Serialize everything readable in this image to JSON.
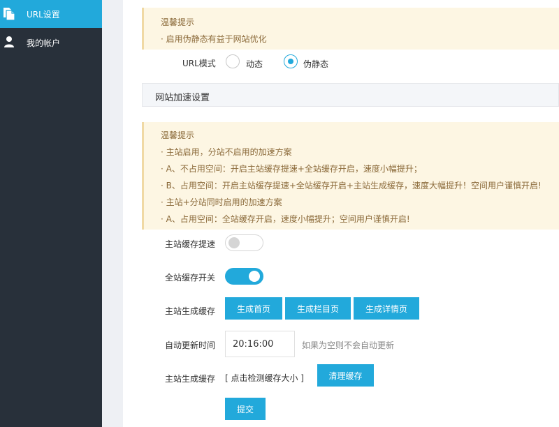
{
  "sidebar": {
    "items": [
      {
        "label": "URL设置",
        "icon": "copy-icon",
        "active": true
      },
      {
        "label": "我的帐户",
        "icon": "user-icon",
        "active": false
      }
    ]
  },
  "tip1": {
    "title": "温馨提示",
    "lines": [
      "· 启用伪静态有益于网站优化"
    ]
  },
  "url_mode": {
    "label": "URL模式",
    "options": [
      {
        "label": "动态",
        "checked": false
      },
      {
        "label": "伪静态",
        "checked": true
      }
    ]
  },
  "section": {
    "title": "网站加速设置"
  },
  "tip2": {
    "title": "温馨提示",
    "lines": [
      "· 主站启用，分站不启用的加速方案",
      "· A、不占用空间：开启主站缓存提速+全站缓存开启，速度小幅提升；",
      "· B、占用空间：开启主站缓存提速+全站缓存开启+主站生成缓存，速度大幅提升！空间用户谨慎开启!",
      "· 主站+分站同时启用的加速方案",
      "· A、占用空间：全站缓存开启，速度小幅提升；空间用户谨慎开启!"
    ]
  },
  "form": {
    "main_cache_speedup": {
      "label": "主站缓存提速",
      "on": false
    },
    "site_cache_switch": {
      "label": "全站缓存开关",
      "on": true
    },
    "generate_cache": {
      "label": "主站生成缓存",
      "buttons": [
        "生成首页",
        "生成栏目页",
        "生成详情页"
      ]
    },
    "auto_update": {
      "label": "自动更新时间",
      "value": "20:16:00",
      "hint": "如果为空则不会自动更新"
    },
    "cache_size": {
      "label": "主站生成缓存",
      "link": "[ 点击检测缓存大小 ]",
      "clear_button": "清理缓存"
    },
    "submit": "提交"
  },
  "colors": {
    "accent": "#22a9db",
    "sidebar_bg": "#28303a",
    "tip_bg": "#fdf6e3",
    "tip_text": "#8b6a3a"
  }
}
